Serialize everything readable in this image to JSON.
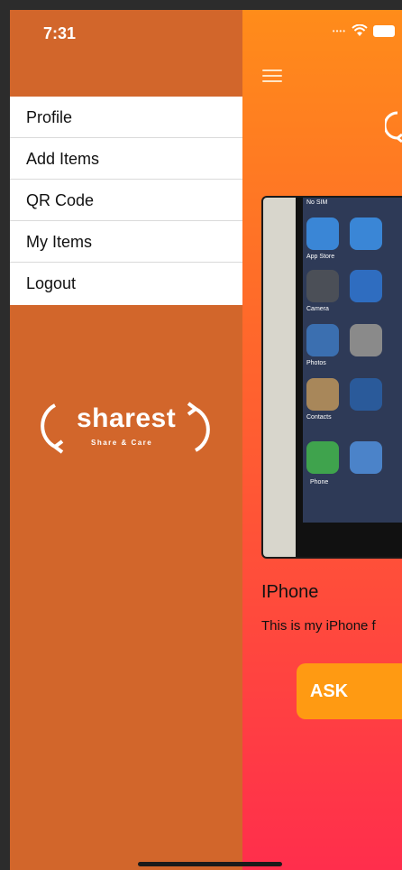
{
  "status_bar": {
    "time": "7:31"
  },
  "drawer": {
    "menu_items": [
      {
        "label": "Profile"
      },
      {
        "label": "Add Items"
      },
      {
        "label": "QR Code"
      },
      {
        "label": "My Items"
      },
      {
        "label": "Logout"
      }
    ],
    "logo": {
      "name": "sharest",
      "tagline": "Share & Care"
    }
  },
  "item": {
    "title": "IPhone",
    "description": "This is my iPhone f",
    "ask_label": "ASK"
  },
  "phone_apps": [
    {
      "label": "App Store"
    },
    {
      "label": "Camera"
    },
    {
      "label": "Photos"
    },
    {
      "label": "Contacts"
    },
    {
      "label": "Phone"
    }
  ],
  "colors": {
    "drawer": "#d2662b",
    "gradient_top": "#ff8c1a",
    "gradient_bottom": "#ff2e4c",
    "ask_button": "#ff9a12"
  },
  "icons": [
    "hamburger-menu-icon",
    "wifi-icon",
    "battery-icon",
    "sharest-logo-icon"
  ]
}
